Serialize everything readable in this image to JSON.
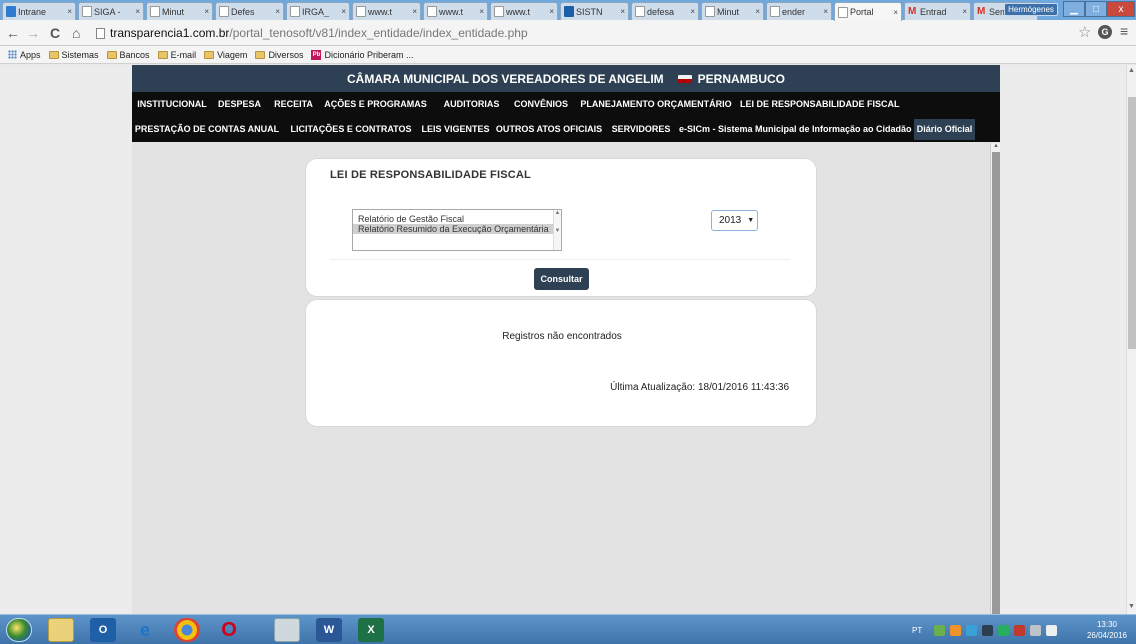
{
  "browser": {
    "tabs": [
      {
        "title": "Intrane",
        "icon": "intranet-icon"
      },
      {
        "title": "SIGA -",
        "icon": "siga-icon"
      },
      {
        "title": "Minut",
        "icon": "page-icon"
      },
      {
        "title": "Defes",
        "icon": "page-icon"
      },
      {
        "title": "IRGA_",
        "icon": "page-icon"
      },
      {
        "title": "www.t",
        "icon": "page-icon"
      },
      {
        "title": "www.t",
        "icon": "page-icon"
      },
      {
        "title": "www.t",
        "icon": "page-icon"
      },
      {
        "title": "SISTN",
        "icon": "sistn-icon"
      },
      {
        "title": "defesa",
        "icon": "page-icon"
      },
      {
        "title": "Minut",
        "icon": "page-icon"
      },
      {
        "title": "ender",
        "icon": "page-icon"
      },
      {
        "title": "Portal",
        "icon": "page-icon",
        "active": true
      },
      {
        "title": "Entrad",
        "icon": "gmail-icon"
      },
      {
        "title": "Semar",
        "icon": "gmail-icon"
      }
    ],
    "tab_close_glyph": "×",
    "profile_name": "Hermógenes",
    "window_controls": {
      "minimize": "▁",
      "maximize": "□",
      "close": "x"
    },
    "nav": {
      "back": "←",
      "forward": "→",
      "reload": "C",
      "home": "⌂"
    },
    "url_host": "transparencia1.com.br",
    "url_path": "/portal_tenosoft/v81/index_entidade/index_entidade.php",
    "bookmarks": [
      {
        "label": "Apps",
        "icon": "apps-icon"
      },
      {
        "label": "Sistemas",
        "icon": "folder-icon"
      },
      {
        "label": "Bancos",
        "icon": "folder-icon"
      },
      {
        "label": "E-mail",
        "icon": "folder-icon"
      },
      {
        "label": "Viagem",
        "icon": "folder-icon"
      },
      {
        "label": "Diversos",
        "icon": "folder-icon"
      },
      {
        "label": "Dicionário Priberam ...",
        "icon": "priberam-icon"
      }
    ],
    "priberam_badge": "Pb"
  },
  "site": {
    "title_left": "CÂMARA MUNICIPAL DOS VEREADORES DE ANGELIM",
    "title_right": "PERNAMBUCO",
    "menu_row_1": [
      "INSTITUCIONAL",
      "DESPESA",
      "RECEITA",
      "AÇÕES E PROGRAMAS",
      "AUDITORIAS",
      "CONVÊNIOS",
      "PLANEJAMENTO ORÇAMENTÁRIO",
      "LEI DE RESPONSABILIDADE FISCAL"
    ],
    "menu_row_2": [
      "PRESTAÇÃO DE CONTAS ANUAL",
      "LICITAÇÕES E CONTRATOS",
      "LEIS VIGENTES",
      "OUTROS ATOS OFICIAIS",
      "SERVIDORES",
      "e-SICm - Sistema Municipal de Informação ao Cidadão",
      "Diário Oficial"
    ],
    "colors": {
      "header": "#2e4053",
      "menu": "#0d0d0d",
      "button": "#2e4053"
    }
  },
  "filter": {
    "heading": "LEI DE RESPONSABILIDADE FISCAL",
    "report_options": [
      {
        "label": "Relatório de Gestão Fiscal",
        "selected": false
      },
      {
        "label": "Relatório Resumido da Execução Orçamentária",
        "selected": true
      }
    ],
    "year_value": "2013",
    "consult_label": "Consultar"
  },
  "result": {
    "message": "Registros não encontrados",
    "last_update": "Última Atualização: 18/01/2016 11:43:36"
  },
  "taskbar": {
    "apps": [
      "start-orb",
      "explorer-icon",
      "outlook-icon",
      "ie-icon",
      "chrome-icon",
      "opera-icon",
      "calculator-icon",
      "word-icon",
      "excel-icon"
    ],
    "tray_lang": "PT",
    "time": "13:30",
    "date": "26/04/2016"
  }
}
